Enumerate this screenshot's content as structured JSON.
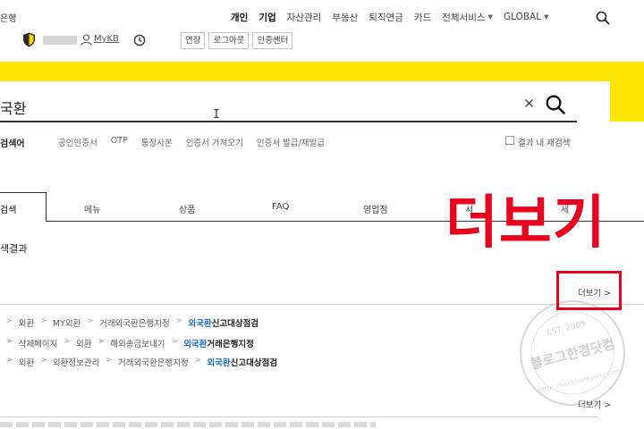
{
  "header": {
    "brand": "은행",
    "nav": [
      {
        "label": "개인",
        "strong": true
      },
      {
        "label": "기업",
        "strong": true
      },
      {
        "label": "자산관리"
      },
      {
        "label": "부동산"
      },
      {
        "label": "퇴직연금"
      },
      {
        "label": "카드"
      }
    ],
    "all_services": "전체서비스",
    "global": "GLOBAL"
  },
  "user_bar": {
    "mykb": "MyKB",
    "buttons": [
      "연장",
      "로그아웃",
      "인증센터"
    ]
  },
  "search": {
    "query": "국환",
    "cursor": "I"
  },
  "keywords": {
    "label": "검색어",
    "items": [
      "공인인증서",
      "OTP",
      "통장사본",
      "인증서 가져오기",
      "인증서 발급/재발급"
    ],
    "research_label": "결과 내 재검색"
  },
  "tabs": [
    "검색",
    "메뉴",
    "상품",
    "FAQ",
    "영업점",
    "서",
    "세"
  ],
  "results": {
    "title": "색결과",
    "more_label": "더보기",
    "overlay": "더보기",
    "paths": [
      {
        "parts": [
          "외환",
          "MY외환",
          "거래외국환은행지정"
        ],
        "hl": "외국환",
        "rest": "신고대상점검"
      },
      {
        "parts": [
          "삭제페이지",
          "외환",
          "해외송금보내기"
        ],
        "hl": "외국환",
        "rest": "거래은행지정"
      },
      {
        "parts": [
          "외환",
          "외환정보관리",
          "거래외국환은행지정"
        ],
        "hl": "외국환",
        "rest": "신고대상점검"
      }
    ]
  },
  "watermark": {
    "main": "블로그한경닷컴",
    "sub": "EST. 2009",
    "ring": "https://blog.hankyung.com"
  },
  "colors": {
    "brand_yellow": "#ffe600",
    "overlay_red": "#e8001d",
    "link_blue": "#1a6fb8"
  }
}
